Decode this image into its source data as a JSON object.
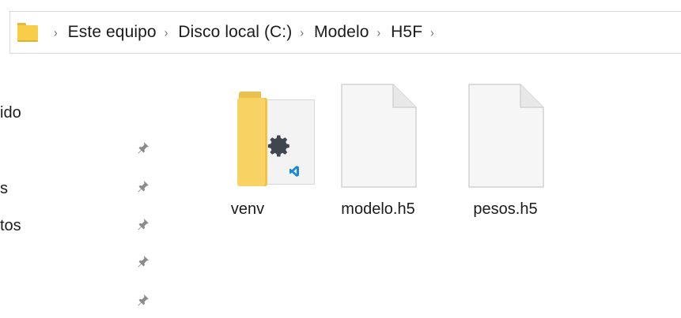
{
  "breadcrumb": {
    "items": [
      "Este equipo",
      "Disco local (C:)",
      "Modelo",
      "H5F"
    ],
    "separator": "›"
  },
  "navigation": {
    "items": [
      {
        "label": "ido",
        "pinned": false
      },
      {
        "label": "",
        "pinned": true
      },
      {
        "label": "s",
        "pinned": true
      },
      {
        "label": "tos",
        "pinned": true
      },
      {
        "label": "",
        "pinned": true
      },
      {
        "label": "",
        "pinned": true
      }
    ]
  },
  "files": [
    {
      "name": "venv",
      "type": "folder",
      "icon": "folder-vscode-icon"
    },
    {
      "name": "modelo.h5",
      "type": "file",
      "icon": "generic-file-icon"
    },
    {
      "name": "pesos.h5",
      "type": "file",
      "icon": "generic-file-icon"
    }
  ],
  "colors": {
    "folder": "#f8d262",
    "folder_dark": "#e6b935",
    "pin": "#8a8a8a",
    "document": "#f6f6f6",
    "vscode_blue": "#1b8ad3"
  }
}
